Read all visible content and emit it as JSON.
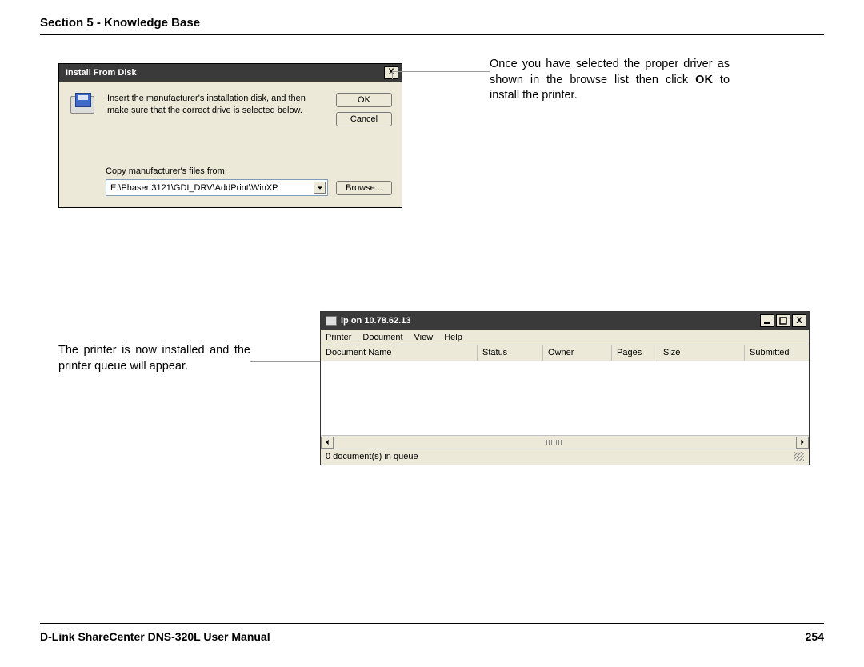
{
  "header": {
    "section_title": "Section 5 - Knowledge Base"
  },
  "install_dialog": {
    "title": "Install From Disk",
    "instruction": "Insert the manufacturer's installation disk, and then make sure that the correct drive is selected below.",
    "ok_label": "OK",
    "cancel_label": "Cancel",
    "copy_label": "Copy manufacturer's files from:",
    "path_value": "E:\\Phaser 3121\\GDI_DRV\\AddPrint\\WinXP",
    "browse_label": "Browse..."
  },
  "right_text": {
    "before_bold": "Once you have selected the proper driver as shown in the browse list then click ",
    "bold": "OK",
    "after_bold": " to install the printer."
  },
  "left_text2": "The printer is now installed and the printer queue will appear.",
  "queue_window": {
    "title": "lp on 10.78.62.13",
    "menu": {
      "printer": "Printer",
      "document": "Document",
      "view": "View",
      "help": "Help"
    },
    "columns": {
      "docname": "Document Name",
      "status": "Status",
      "owner": "Owner",
      "pages": "Pages",
      "size": "Size",
      "submitted": "Submitted"
    },
    "status_text": "0 document(s) in queue"
  },
  "footer": {
    "manual": "D-Link ShareCenter DNS-320L User Manual",
    "page": "254"
  }
}
